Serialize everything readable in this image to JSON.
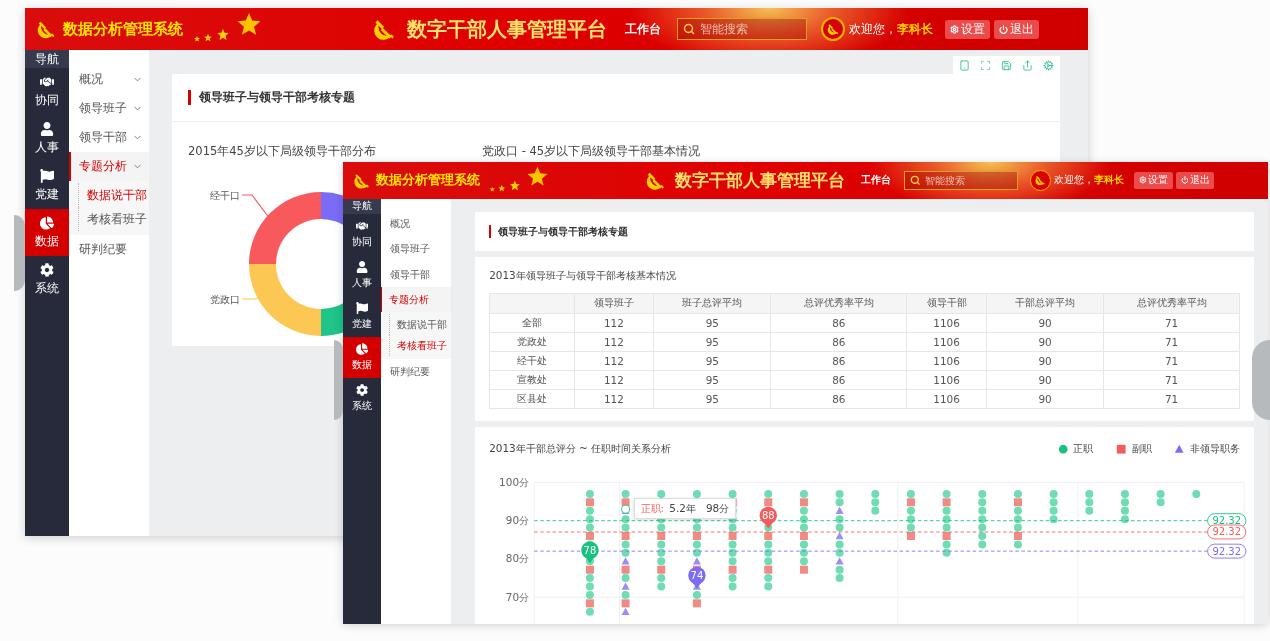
{
  "windows": [
    {
      "kind": "distribution",
      "header": {
        "system_title": "数据分析管理系统",
        "platform_title": "数字干部人事管理平台",
        "workbench": "工作台",
        "search": {
          "placeholder": "智能搜索"
        },
        "greeting": "欢迎您，",
        "user_name": "李科长",
        "buttons": [
          "设置",
          "退出"
        ]
      },
      "nav": {
        "heading": "导航",
        "items": [
          {
            "label": "协同",
            "selected": false
          },
          {
            "label": "人事",
            "selected": false
          },
          {
            "label": "党建",
            "selected": false
          },
          {
            "label": "数据",
            "selected": true
          },
          {
            "label": "系统",
            "selected": false
          }
        ]
      },
      "menu": [
        {
          "label": "概况",
          "selected": false,
          "collapsible": true
        },
        {
          "label": "领导班子",
          "selected": false,
          "collapsible": true
        },
        {
          "label": "领导干部",
          "selected": false,
          "collapsible": true
        },
        {
          "label": "专题分析",
          "selected": true,
          "collapsible": true,
          "children": [
            {
              "label": "数据说干部",
              "selected": true
            },
            {
              "label": "考核看班子",
              "selected": false
            }
          ]
        },
        {
          "label": "研判纪要",
          "selected": false
        }
      ],
      "page_title": "领导班子与领导干部考核专题",
      "sections": [
        {
          "title": "2015年45岁以下局级领导干部分布",
          "labels": [
            "经干口",
            "党政口"
          ]
        },
        {
          "title": "党政口 - 45岁以下局级领导干部基本情况"
        }
      ]
    },
    {
      "kind": "assessment",
      "header": {
        "system_title": "数据分析管理系统",
        "platform_title": "数字干部人事管理平台",
        "workbench": "工作台",
        "search": {
          "placeholder": "智能搜索"
        },
        "greeting": "欢迎您，",
        "user_name": "李科长",
        "buttons": [
          "设置",
          "退出"
        ]
      },
      "nav": {
        "heading": "导航",
        "items": [
          {
            "label": "协同",
            "selected": false
          },
          {
            "label": "人事",
            "selected": false
          },
          {
            "label": "党建",
            "selected": false
          },
          {
            "label": "数据",
            "selected": true
          },
          {
            "label": "系统",
            "selected": false
          }
        ]
      },
      "menu": [
        {
          "label": "概况",
          "selected": false
        },
        {
          "label": "领导班子",
          "selected": false
        },
        {
          "label": "领导干部",
          "selected": false
        },
        {
          "label": "专题分析",
          "selected": true,
          "children": [
            {
              "label": "数据说干部",
              "selected": false
            },
            {
              "label": "考核看班子",
              "selected": true
            }
          ]
        },
        {
          "label": "研判纪要",
          "selected": false
        }
      ],
      "page_title": "领导班子与领导干部考核专题",
      "table": {
        "title": "2013年领导班子与领导干部考核基本情况",
        "columns": [
          "领导班子",
          "班子总评平均",
          "总评优秀率平均",
          "领导干部",
          "干部总评平均",
          "总评优秀率平均"
        ],
        "rows": [
          {
            "label": "全部",
            "cells": [
              "112",
              "95",
              "86",
              "1106",
              "90",
              "71"
            ]
          },
          {
            "label": "党政处",
            "cells": [
              "112",
              "95",
              "86",
              "1106",
              "90",
              "71"
            ]
          },
          {
            "label": "经干处",
            "cells": [
              "112",
              "95",
              "86",
              "1106",
              "90",
              "71"
            ]
          },
          {
            "label": "宣教处",
            "cells": [
              "112",
              "95",
              "86",
              "1106",
              "90",
              "71"
            ]
          },
          {
            "label": "区县处",
            "cells": [
              "112",
              "95",
              "86",
              "1106",
              "90",
              "71"
            ]
          }
        ]
      },
      "chart": {
        "title": "2013年干部总评分 ~ 任职时间关系分析",
        "legend": [
          {
            "label": "正职",
            "kind": "circle",
            "color": "#19c180"
          },
          {
            "label": "副职",
            "kind": "square",
            "color": "#f45b5b"
          },
          {
            "label": "非领导职务",
            "kind": "triangle",
            "color": "#7b6cf6"
          }
        ],
        "y_ticks": [
          "100分",
          "90分",
          "80分",
          "70分"
        ],
        "reference_lines": [
          {
            "label": "92.32",
            "color": "#19c180"
          },
          {
            "label": "92.32",
            "color": "#f45b5b"
          },
          {
            "label": "92.32",
            "color": "#7b6cf6"
          }
        ],
        "tooltip": {
          "label": "正职:",
          "value": "5.2年   98分"
        },
        "pins": [
          {
            "text": "78",
            "color": "#19c180"
          },
          {
            "text": "88",
            "color": "#f45b5b"
          },
          {
            "text": "74",
            "color": "#7b6cf6"
          }
        ]
      }
    }
  ]
}
